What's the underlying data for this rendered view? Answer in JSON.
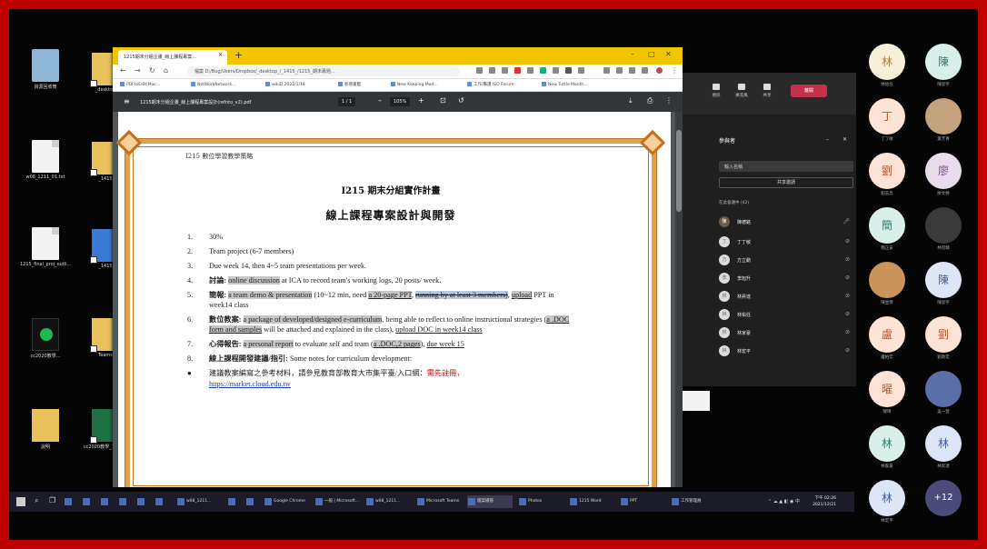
{
  "desktop": {
    "icons": [
      {
        "label": "資源回收筒",
        "type": "recycle"
      },
      {
        "label": "_desktop",
        "type": "folder"
      },
      {
        "label": "w08_1211_01.txt",
        "type": "file"
      },
      {
        "label": "_1415",
        "type": "folder"
      },
      {
        "label": "1215_final_proj_outli...",
        "type": "file"
      },
      {
        "label": "_1415",
        "type": "folder"
      },
      {
        "label": "cc2020教學...",
        "type": "app"
      },
      {
        "label": "Teams",
        "type": "folder"
      },
      {
        "label": "說明",
        "type": "folder"
      },
      {
        "label": "cc2020教學_1215...",
        "type": "excel"
      }
    ]
  },
  "browser": {
    "tab_title": "1215期末分組企畫_線上課程專案...",
    "url": "檔案  D:/Bug/Users/Dropbox/_desktop_/_1415_/1215_期末專題...",
    "bookmarks": [
      "PDFtoEdit(Mac...",
      "NetWorkNetwork...",
      "wikiD 2022/1/18",
      "新增書籤",
      "New Keeping Mod...",
      "工作/備課 ISO Forum",
      "New Tuttle Month..."
    ],
    "pdf": {
      "filename": "1215期末分組企畫_線上課程專案設計(refnto_v2).pdf",
      "page": "1 / 1",
      "zoom": "105%"
    }
  },
  "document": {
    "header": "I215  數位學習教學策略",
    "title1": "I215  期末分組實作計畫",
    "title2": "線上課程專案設計與開發",
    "items": [
      {
        "num": "1.",
        "text": "30%"
      },
      {
        "num": "2.",
        "text": "Team project (6-7 members)"
      },
      {
        "num": "3.",
        "text": "Due week 14, then 4~5 team presentations per week."
      },
      {
        "num": "4.",
        "t1": "討論: ",
        "t2": "online discussion",
        "t3": " at ICA to record team's working logs, 20 posts/ week."
      },
      {
        "num": "5.",
        "t1": "簡報: ",
        "t2": "a team demo & presentation",
        "t3": " (10~12 min, need ",
        "t4": "a 20-page PPT",
        "t5": ", ",
        "t6": "running by at least 3 members)",
        "t7": ", ",
        "t8": "upload",
        "t9": " PPT in week14 class"
      },
      {
        "num": "6.",
        "t1": "數位教案: ",
        "t2": "a package of developed/designed e-curriculum",
        "t3": ", being able to reflect to online instructional strategies (",
        "t4": "a .DOC form and samples",
        "t5": " will be attached and explained in the class), ",
        "t6": "upload DOC in week14 class"
      },
      {
        "num": "7.",
        "t1": "心得報告: ",
        "t2": "a personal report",
        "t3": " to evaluate self and team (",
        "t4": "a .DOC,2 pages",
        "t5": "), ",
        "t6": "due week 15"
      },
      {
        "num": "8.",
        "t1": "線上課程開發建議/指引: ",
        "t2": "Some notes for curriculum development:"
      }
    ],
    "bullet": {
      "text": "建議教案編寫之參考材料，請參見教育部教育大市集平臺/入口網：",
      "red": "需先註冊，",
      "link": "https://market.cloud.edu.tw"
    }
  },
  "teams": {
    "buttons": [
      "視訊",
      "麥克風",
      "共享",
      "更多"
    ],
    "leave": "離開",
    "panel_title": "參與者",
    "search_placeholder": "輸入名稱",
    "share_invite": "共享邀請",
    "section": "在此會議中 (42)",
    "participants": [
      {
        "initial": "陳",
        "name": "陳德銘",
        "sub": "召集人"
      },
      {
        "initial": "丁",
        "name": "丁丁敏"
      },
      {
        "initial": "方",
        "name": "方立勳"
      },
      {
        "initial": "李",
        "name": "李旭升"
      },
      {
        "initial": "林",
        "name": "林昇達"
      },
      {
        "initial": "林",
        "name": "林佑任"
      },
      {
        "initial": "林",
        "name": "林家豪"
      },
      {
        "initial": "林",
        "name": "林宏平"
      }
    ]
  },
  "gallery": [
    {
      "initial": "林",
      "name": "林佑任",
      "bg": "#f7efd8",
      "fg": "#a8823a"
    },
    {
      "initial": "陳",
      "name": "陳思宇",
      "bg": "#d9f0ea",
      "fg": "#2e7d6b"
    },
    {
      "initial": "丁",
      "name": "丁丁敏",
      "bg": "#fde2d6",
      "fg": "#b4552f"
    },
    {
      "initial": "",
      "name": "葉芳菁",
      "bg": "#c4a27e",
      "fg": "#fff"
    },
    {
      "initial": "劉",
      "name": "劉志昌",
      "bg": "#fde2d6",
      "fg": "#b4552f"
    },
    {
      "initial": "廖",
      "name": "廖文婷",
      "bg": "#e8dcec",
      "fg": "#7a4f8a"
    },
    {
      "initial": "簡",
      "name": "簡正安",
      "bg": "#d9f0ea",
      "fg": "#2e7d6b"
    },
    {
      "initial": "",
      "name": "林宛臻",
      "bg": "#3a3a3a",
      "fg": "#fff"
    },
    {
      "initial": "",
      "name": "陳昱傑",
      "bg": "#c9935a",
      "fg": "#fff"
    },
    {
      "initial": "陳",
      "name": "陳思宇",
      "bg": "#dde6f7",
      "fg": "#3e5d9c"
    },
    {
      "initial": "盧",
      "name": "盧柏宏",
      "bg": "#fde2d6",
      "fg": "#b4552f"
    },
    {
      "initial": "劉",
      "name": "劉政宏",
      "bg": "#fde2d6",
      "fg": "#b4552f"
    },
    {
      "initial": "曜",
      "name": "曜晴",
      "bg": "#fde2d6",
      "fg": "#b4552f"
    },
    {
      "initial": "",
      "name": "吳一萱",
      "bg": "#5a6ea8",
      "fg": "#fff"
    },
    {
      "initial": "林",
      "name": "林家豪",
      "bg": "#d9f0ea",
      "fg": "#2e7d6b"
    },
    {
      "initial": "林",
      "name": "林昇達",
      "bg": "#dde6f7",
      "fg": "#3e5d9c"
    },
    {
      "initial": "林",
      "name": "林宏平",
      "bg": "#dde6f7",
      "fg": "#3e5d9c"
    },
    {
      "initial": "+12",
      "name": "",
      "bg": "#4b4a7a",
      "fg": "#fff"
    }
  ],
  "taskbar": {
    "items": [
      "w08_1211...",
      "",
      "Google Chrome",
      "Microsoft Teams",
      "一般 | Microsoft...",
      "w08_1211...",
      "",
      "Photos",
      "檔案總管",
      "Windows",
      "1215 Word",
      "PPT",
      "工作管理員"
    ],
    "time": "下午 02:26",
    "date": "2021/12/21"
  },
  "colors": {
    "accent_tab": "#f2c500",
    "frame": "#c00000",
    "pdf_border": "#e0a050",
    "leave": "#c4314b"
  }
}
